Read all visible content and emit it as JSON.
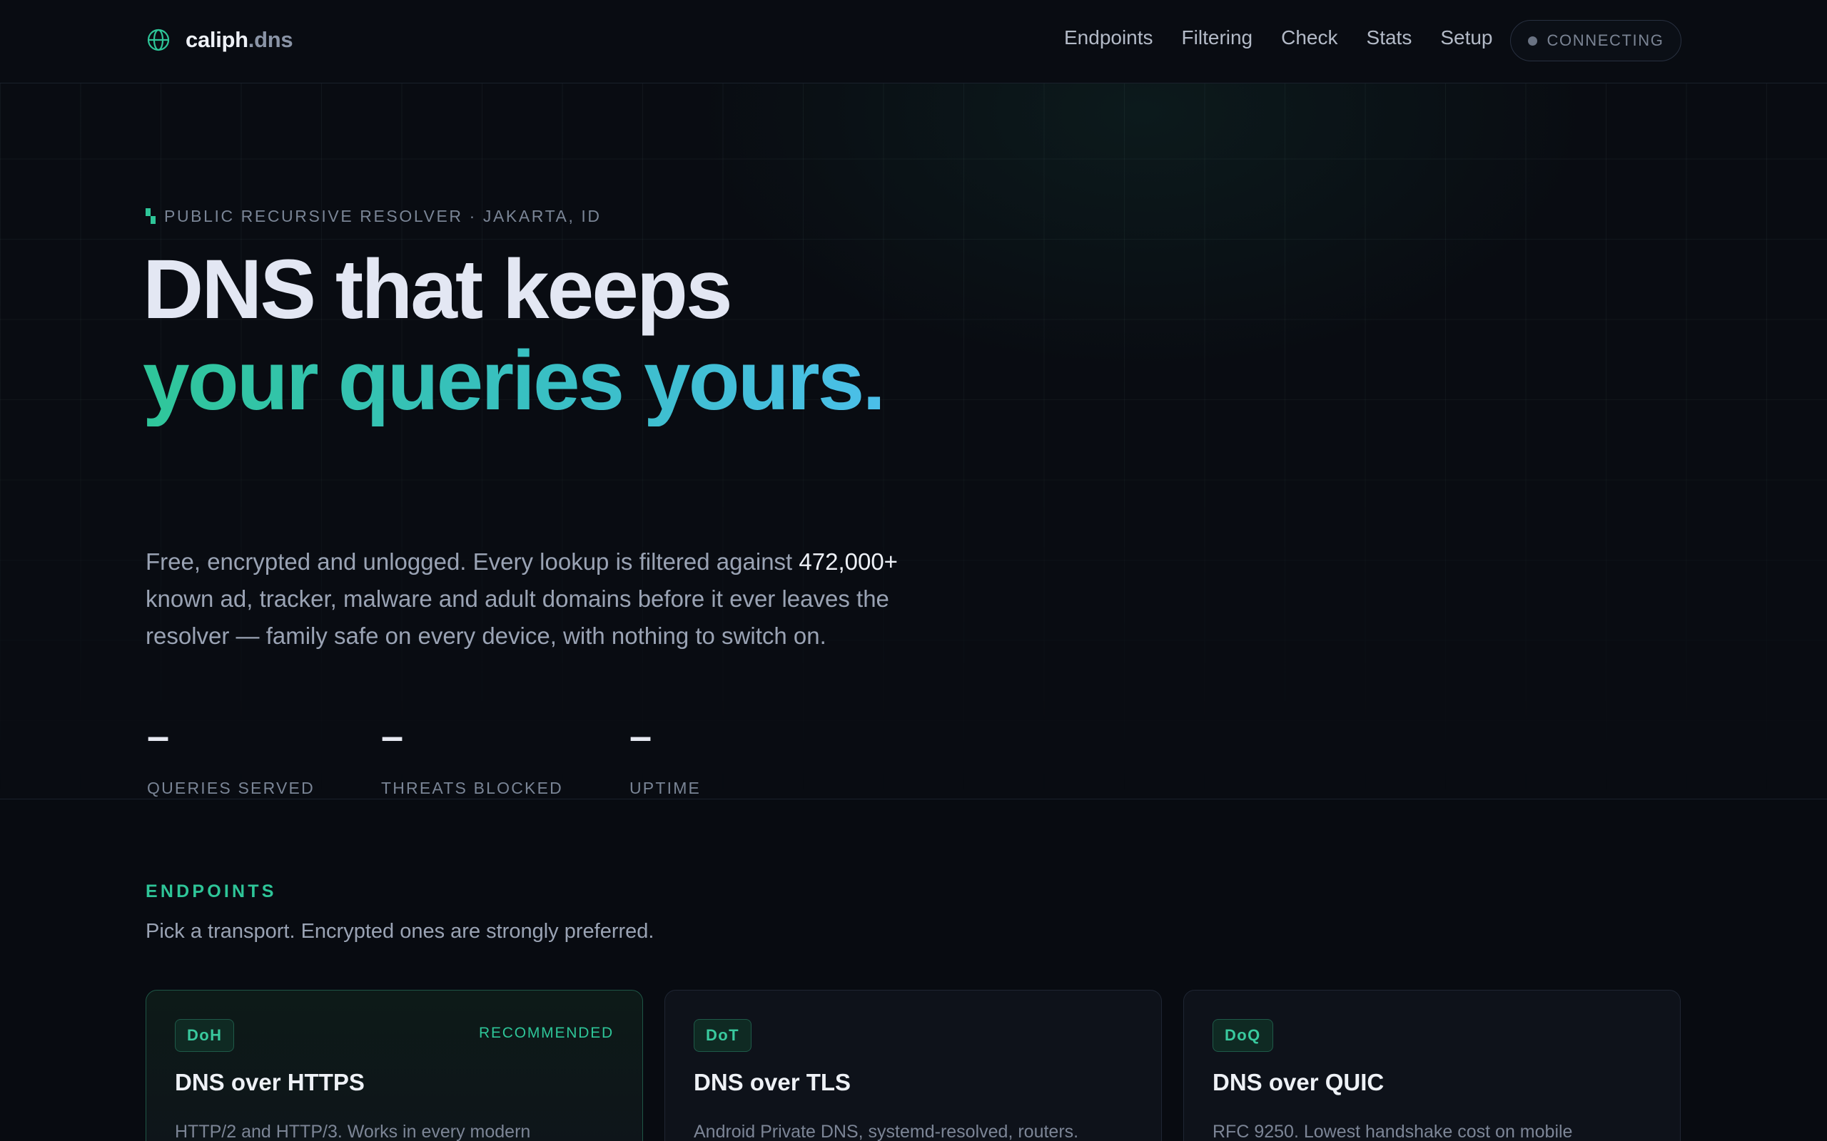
{
  "brand": {
    "name": "caliph",
    "tld": ".dns"
  },
  "nav": {
    "links": [
      "Endpoints",
      "Filtering",
      "Check",
      "Stats",
      "Setup"
    ],
    "status": "CONNECTING"
  },
  "hero": {
    "eyebrow": "PUBLIC RECURSIVE RESOLVER · JAKARTA, ID",
    "headline_line1": "DNS that keeps",
    "headline_line2": "your queries yours.",
    "lede_before": "Free, encrypted and unlogged. Every lookup is filtered against ",
    "lede_highlight": "472,000+",
    "lede_after": " known ad, tracker, malware and adult domains before it ever leaves the resolver — family safe on every device, with nothing to switch on.",
    "stats": [
      {
        "value": "–",
        "label": "QUERIES SERVED"
      },
      {
        "value": "–",
        "label": "THREATS BLOCKED"
      },
      {
        "value": "–",
        "label": "UPTIME"
      }
    ]
  },
  "endpoints": {
    "label": "ENDPOINTS",
    "subtitle": "Pick a transport. Encrypted ones are strongly preferred.",
    "cards": [
      {
        "badge": "DoH",
        "recommended": "RECOMMENDED",
        "title": "DNS over HTTPS",
        "desc": "HTTP/2 and HTTP/3. Works in every modern"
      },
      {
        "badge": "DoT",
        "title": "DNS over TLS",
        "desc": "Android Private DNS, systemd-resolved, routers."
      },
      {
        "badge": "DoQ",
        "title": "DNS over QUIC",
        "desc": "RFC 9250. Lowest handshake cost on mobile"
      }
    ]
  },
  "colors": {
    "accent": "#2ec598",
    "accent_blue": "#4bbfe9",
    "background": "#080b11"
  }
}
